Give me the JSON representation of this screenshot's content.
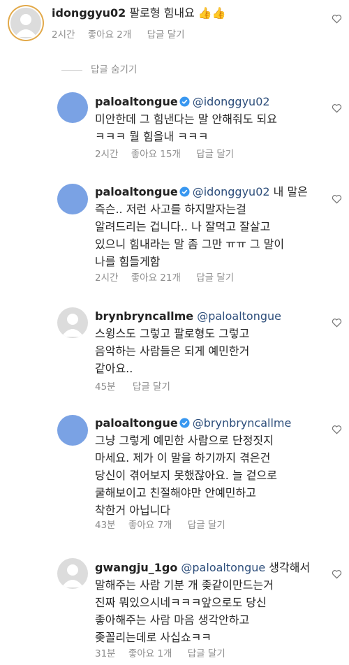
{
  "hide_replies_label": "답글 숨기기",
  "like_label": "좋아요",
  "reply_label": "답글 달기",
  "comments": [
    {
      "user": "idonggyu02",
      "mention": "",
      "text": "팔로형 힘내요 👍👍",
      "time": "2시간",
      "likes": "2개"
    },
    {
      "user": "paloaltongue",
      "mention": "@idonggyu02",
      "text": "미안한데 그 힘낸다는 말 안해줘도 되요\nㅋㅋㅋ 뭘 힘을내 ㅋㅋㅋ",
      "time": "2시간",
      "likes": "15개"
    },
    {
      "user": "paloaltongue",
      "mention": "@idonggyu02",
      "text": " 내 말은\n즉슨.. 저런 사고를 하지말자는걸\n알려드리는 겁니다.. 나 잘먹고 잘살고\n있으니 힘내라는 말 좀 그만 ㅠㅠ 그 말이\n나를 힘들게함",
      "time": "2시간",
      "likes": "21개"
    },
    {
      "user": "brynbryncallme",
      "mention": "@paloaltongue",
      "text": "스윙스도 그렇고 팔로형도 그렇고\n음악하는 사람들은 되게 예민한거\n같아요..",
      "time": "45분",
      "likes": ""
    },
    {
      "user": "paloaltongue",
      "mention": "@brynbryncallme",
      "text": "그냥 그렇게 예민한 사람으로 단정짓지\n마세요. 제가 이 말을 하기까지 겪은건\n당신이 겪어보지 못했잖아요. 늘 겉으로\n쿨해보이고 친절해야만 안예민하고\n착한거 아닙니다",
      "time": "43분",
      "likes": "7개"
    },
    {
      "user": "gwangju_1go",
      "mention": "@paloaltongue",
      "text": " 생각해서\n말해주는 사람 기분 개 좆같이만드는거\n진짜 뭐있으시네ㅋㅋㅋ앞으로도 당신\n좋아해주는 사람 마음 생각안하고\n좆꼴리는데로 사십쇼ㅋㅋ",
      "time": "31분",
      "likes": "1개"
    }
  ]
}
